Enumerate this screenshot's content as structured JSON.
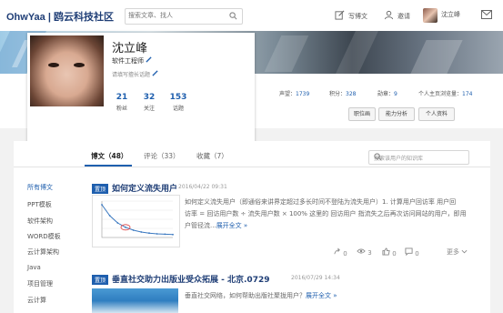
{
  "header": {
    "logo": "OhwYaa | 鸥云科技社区",
    "search_placeholder": "搜索文章、找人",
    "write": "写博文",
    "invite": "邀请",
    "username": "沈立峰"
  },
  "profile": {
    "name": "沈立峰",
    "job_title": "软件工程师",
    "hint": "请填写擅长话题",
    "stats": [
      {
        "value": "21",
        "label": "粉丝"
      },
      {
        "value": "32",
        "label": "关注"
      },
      {
        "value": "153",
        "label": "话题"
      }
    ]
  },
  "metrics": {
    "reputation_label": "声望：",
    "reputation_value": "1739",
    "points_label": "积分：",
    "points_value": "328",
    "rank_label": "勋章：",
    "rank_value": "9",
    "visits_label": "个人主页浏览量：",
    "visits_value": "174"
  },
  "buttons": {
    "career": "职位画",
    "ability": "能力分析",
    "profile": "个人资料"
  },
  "tabs": [
    {
      "label": "博文（48）"
    },
    {
      "label": "评论（33）"
    },
    {
      "label": "收藏（7）"
    }
  ],
  "post_search_placeholder": "搜索该用户的知识库",
  "categories": [
    "所有博文",
    "PPT模板",
    "软件架构",
    "WORD模板",
    "云计算架构",
    "Java",
    "项目管理",
    "云计算"
  ],
  "posts": [
    {
      "tag": "置顶",
      "title": "如何定义流失用户",
      "date": "2016/04/22 09:31",
      "summary_lines": [
        "如何定义流失用户（即通俗来讲界定超过多长时间不登陆为流失用户）1. 计算用户回访率 用户回",
        "访率 = 回访用户数 ÷ 流失用户数 × 100% 这里的 回访用户 指流失之后再次访问网站的用户，即用",
        "户管径流..."
      ],
      "more": "展开全文 »",
      "repost": "0",
      "views": "3",
      "likes": "0",
      "comments": "0",
      "more_menu": "更多"
    },
    {
      "tag": "置顶",
      "title": "垂直社交助力出版业受众拓展 - 北京.0729",
      "date": "2016/07/29 14:34",
      "summary": "垂直社交网络，如何帮助出版社聚拢用户？",
      "more": "展开全文 »"
    }
  ],
  "chart_data": {
    "type": "line",
    "x": [
      1,
      2,
      3,
      4,
      5,
      6,
      7,
      8,
      9,
      10
    ],
    "values": [
      90,
      60,
      40,
      28,
      20,
      15,
      12,
      10,
      9,
      8
    ],
    "title": "",
    "xlabel": "",
    "ylabel": ""
  }
}
